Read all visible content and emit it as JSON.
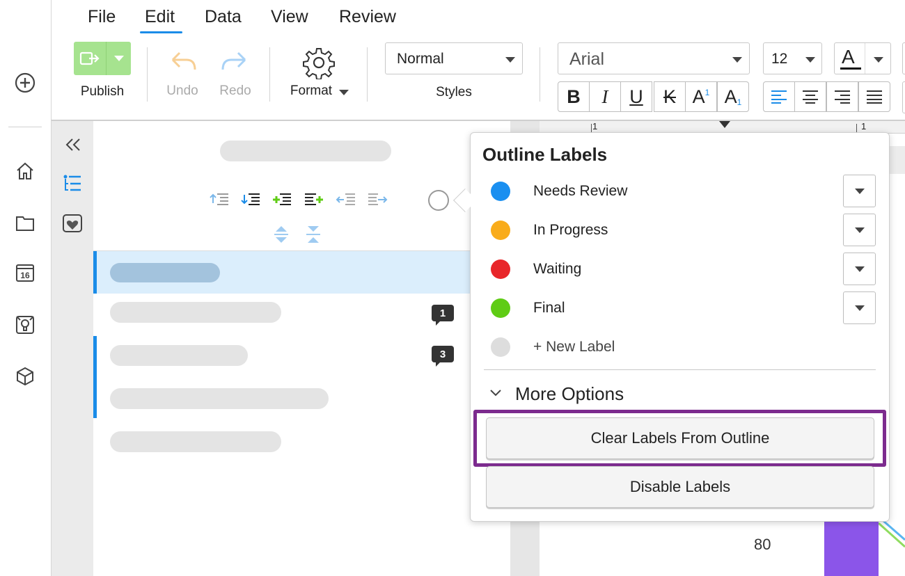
{
  "menu": {
    "items": [
      "File",
      "Edit",
      "Data",
      "View",
      "Review"
    ],
    "active": "Edit"
  },
  "toolbar": {
    "publish_label": "Publish",
    "undo_label": "Undo",
    "redo_label": "Redo",
    "format_label": "Format",
    "style_value": "Normal",
    "styles_label": "Styles",
    "font_value": "Arial",
    "font_size_value": "12",
    "bold": "B",
    "italic": "I",
    "underline": "U",
    "strike": "K",
    "superscript": "A",
    "superscript_digit": "1",
    "subscript": "A",
    "subscript_digit": "1",
    "font_color_glyph": "A"
  },
  "ruler": {
    "tick_left": "1",
    "tick_right": "1"
  },
  "outline": {
    "comment_counts": [
      "1",
      "3"
    ]
  },
  "popover": {
    "title": "Outline Labels",
    "labels": [
      {
        "name": "Needs Review",
        "color": "#1a8ff0"
      },
      {
        "name": "In Progress",
        "color": "#f9ac1b"
      },
      {
        "name": "Waiting",
        "color": "#e8262a"
      },
      {
        "name": "Final",
        "color": "#5fcc15"
      }
    ],
    "new_label": "+ New Label",
    "new_label_color": "#dddddd",
    "more_options": "More Options",
    "clear_button": "Clear Labels From Outline",
    "disable_button": "Disable Labels",
    "highlight_color": "#7c2b8e"
  },
  "canvas": {
    "axis_value": "80",
    "bar_color": "#8b55e9"
  }
}
